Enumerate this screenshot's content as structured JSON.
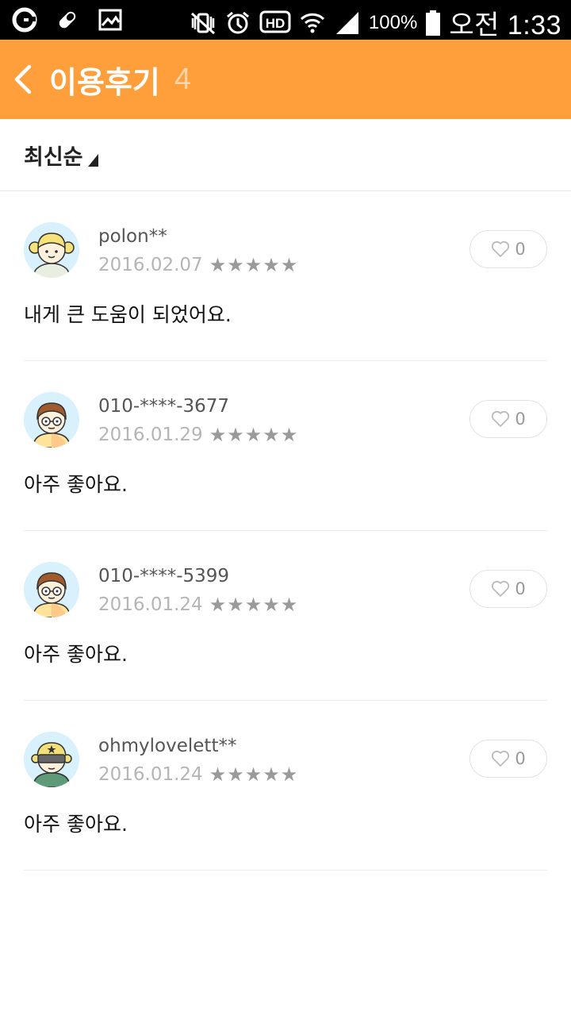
{
  "status_bar": {
    "left_icons": [
      "notification-app-icon",
      "pill-icon",
      "image-icon"
    ],
    "right_icons": [
      "vibrate-mute-icon",
      "alarm-icon",
      "hd-voice-icon",
      "wifi-icon",
      "signal-icon"
    ],
    "battery_percent": "100%",
    "time": "오전 1:33"
  },
  "header": {
    "back_icon": "chevron-left-icon",
    "title": "이용후기",
    "count": "4",
    "background": "#ff9f3b"
  },
  "sort": {
    "label": "최신순"
  },
  "reviews": [
    {
      "username": "polon**",
      "date": "2016.02.07",
      "rating": 5,
      "likes": "0",
      "comment": "내게 큰 도움이 되었어요.",
      "avatar": "girl-avatar-icon"
    },
    {
      "username": "010-****-3677",
      "date": "2016.01.29",
      "rating": 5,
      "likes": "0",
      "comment": "아주 좋아요.",
      "avatar": "boy-glasses-avatar-icon"
    },
    {
      "username": "010-****-5399",
      "date": "2016.01.24",
      "rating": 5,
      "likes": "0",
      "comment": "아주 좋아요.",
      "avatar": "boy-glasses-avatar-icon"
    },
    {
      "username": "ohmylovelett**",
      "date": "2016.01.24",
      "rating": 5,
      "likes": "0",
      "comment": "아주 좋아요.",
      "avatar": "visor-avatar-icon"
    }
  ],
  "colors": {
    "accent": "#ff9f3b",
    "star": "#9a9a9a",
    "date": "#b5b5b5"
  }
}
